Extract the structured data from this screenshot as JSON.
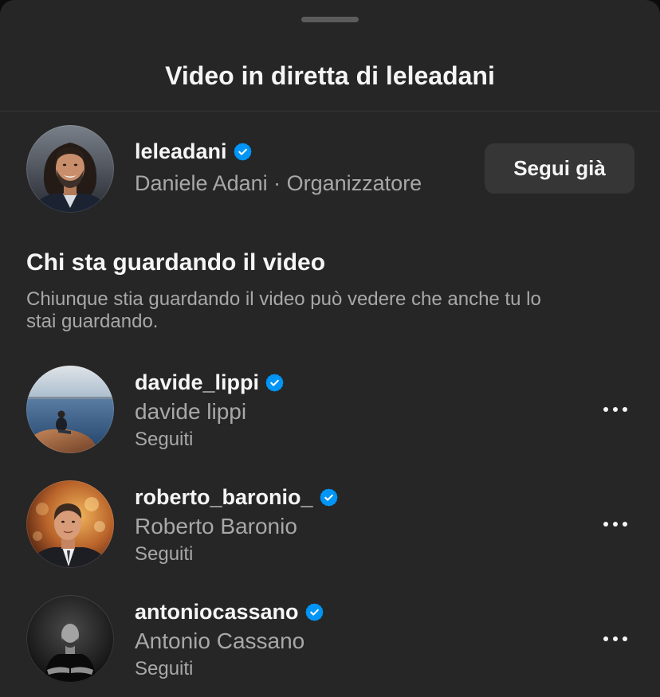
{
  "sheet": {
    "title": "Video in diretta di leleadani"
  },
  "host": {
    "username": "leleadani",
    "verified": true,
    "subtitle": "Daniele Adani · Organizzatore",
    "follow_button_label": "Segui già"
  },
  "viewers_section": {
    "heading": "Chi sta guardando il video",
    "description": "Chiunque stia guardando il video può vedere che anche tu lo stai guardando."
  },
  "viewers": [
    {
      "username": "davide_lippi",
      "verified": true,
      "full_name": "davide lippi",
      "status": "Seguiti"
    },
    {
      "username": "roberto_baronio_",
      "verified": true,
      "full_name": "Roberto Baronio",
      "status": "Seguiti"
    },
    {
      "username": "antoniocassano",
      "verified": true,
      "full_name": "Antonio Cassano",
      "status": "Seguiti"
    }
  ],
  "icons": {
    "verified": "verified-badge-icon",
    "more_options": "more-horizontal-icon"
  },
  "colors": {
    "sheet_background": "#262626",
    "text_primary": "#f5f5f5",
    "text_secondary": "#a8a8a8",
    "divider": "#363636",
    "button_background": "#363636",
    "verified_blue": "#0095f6",
    "handle": "#5c5c5c"
  }
}
